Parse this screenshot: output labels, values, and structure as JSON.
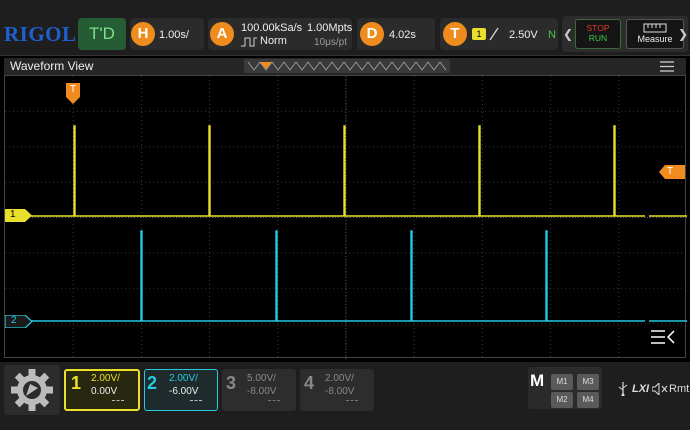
{
  "brand": "RIGOL",
  "trigger_mode_label": "T'D",
  "horizontal": {
    "badge": "H",
    "timebase": "1.00s/"
  },
  "acquire": {
    "badge": "A",
    "sample_rate": "100.00kSa/s",
    "memory_depth": "1.00Mpts",
    "mode": "Norm",
    "time_per_point": "10μs/pt"
  },
  "delay": {
    "badge": "D",
    "value": "4.02s"
  },
  "trigger": {
    "badge": "T",
    "source_channel": "1",
    "level": "2.50V",
    "coupling": "N"
  },
  "run_control": {
    "stop_label": "STOP",
    "run_label": "RUN",
    "measure_label": "Measure"
  },
  "waveform_view": {
    "title": "Waveform View"
  },
  "channels": [
    {
      "number": "1",
      "scale": "2.00V/",
      "offset": "0.00V",
      "color": "#e8e02a",
      "active": true
    },
    {
      "number": "2",
      "scale": "2.00V/",
      "offset": "-6.00V",
      "color": "#25c9e0",
      "active": true
    },
    {
      "number": "3",
      "scale": "5.00V/",
      "offset": "-8.00V",
      "color": "#888888",
      "active": false
    },
    {
      "number": "4",
      "scale": "2.00V/",
      "offset": "-8.00V",
      "color": "#888888",
      "active": false
    }
  ],
  "math": {
    "badge": "M",
    "buttons": [
      "M1",
      "M3",
      "M2",
      "M4"
    ]
  },
  "status": {
    "lxi": "LXI",
    "remote": "Rmt"
  },
  "markers": {
    "ch1": "1",
    "ch2": "2",
    "trigger_top": "T",
    "trigger_level": "T"
  },
  "colors": {
    "accent": "#f08c1e",
    "ch1": "#e8e02a",
    "ch2": "#25c9e0",
    "grid": "#3a3a3a"
  },
  "icons": [
    "right-arrow-icon",
    "left-arrow-icon",
    "menu-icon",
    "settings-gear-icon",
    "usb-icon",
    "speaker-muted-icon",
    "collapse-menu-icon"
  ]
}
